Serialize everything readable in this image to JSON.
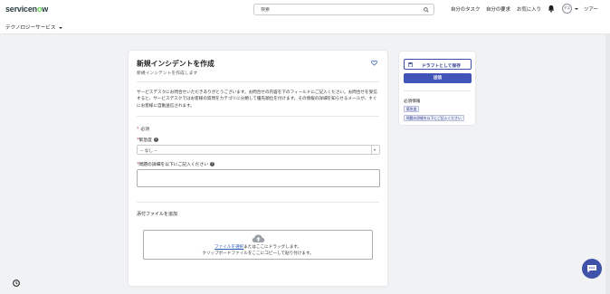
{
  "header": {
    "logo": {
      "part1": "servicen",
      "part2": "o",
      "part3": "w"
    },
    "search_placeholder": "検索",
    "nav": [
      "自分のタスク",
      "自分の要求",
      "お気に入り"
    ],
    "avatar_initials": "デス",
    "tour": "ツアー"
  },
  "subnav": {
    "menu_label": "テクノロジーサービス"
  },
  "form": {
    "title": "新規インシデントを作成",
    "subtitle": "新規インシデントを作成します",
    "description": "サービスデスクにお問合せいただきありがとうございます。お問合せの内容を下のフィールドにご記入ください。お問合せを受信すると、サービスデスクではお客様の質問をカテゴリに分類して優先順位を付けます。その情報の詳細を知らせるメールが、すぐにお客様に自動送信されます。",
    "required_note": "必須",
    "urgency": {
      "label": "緊急度",
      "value": "-- なし --"
    },
    "details": {
      "label": "問題の詳細を以下にご記入ください",
      "value": ""
    },
    "attach": {
      "title": "添付ファイルを追加",
      "link": "ファイルを選択",
      "line1_rest": "またはここにドラッグします。",
      "line2": "クリップボードファイルをここにコピーして貼り付けます。"
    }
  },
  "side": {
    "draft_button": "ドラフトとして保存",
    "submit_button": "送信",
    "required_title": "必須情報",
    "required_chips": [
      "緊急度",
      "問題の詳細を以下にご記入ください"
    ]
  },
  "colors": {
    "primary": "#4154b8",
    "required": "#c83c36",
    "link": "#2f5bb7",
    "logo_green": "#62d84e"
  }
}
